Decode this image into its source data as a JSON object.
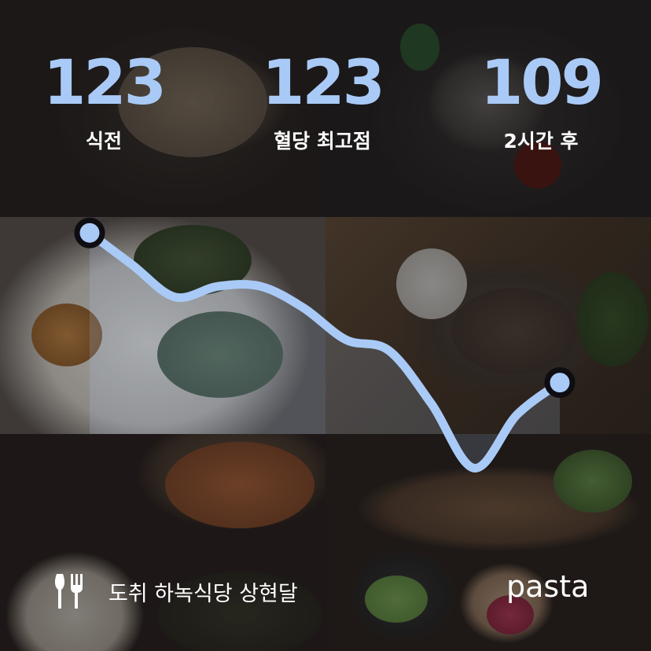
{
  "stats": [
    {
      "value": "123",
      "label": "식전"
    },
    {
      "value": "123",
      "label": "혈당 최고점"
    },
    {
      "value": "109",
      "label": "2시간 후"
    }
  ],
  "footer": {
    "icon": "fork-knife-icon",
    "restaurant": "도취 하녹식당 상현달",
    "brand": "pasta"
  },
  "colors": {
    "accent": "#a9caf6",
    "curve_stroke": "#a9caf6",
    "curve_fill": "rgba(176, 205, 245, 0.18)",
    "marker_ring": "#0d0d12",
    "text": "#ffffff"
  },
  "chart_data": {
    "type": "line",
    "title": "",
    "xlabel": "",
    "ylabel": "",
    "x": [
      0,
      1,
      2,
      3,
      4,
      5,
      6,
      7,
      8,
      9,
      10,
      11,
      12
    ],
    "series": [
      {
        "values": [
          123,
          120,
          117,
          118,
          118,
          116,
          113,
          112,
          107,
          101,
          106,
          109
        ]
      }
    ],
    "start_value": 123,
    "end_value": 109,
    "endpoint_markers": true,
    "grid": false,
    "legend": "none",
    "ylim": [
      95,
      125
    ]
  }
}
